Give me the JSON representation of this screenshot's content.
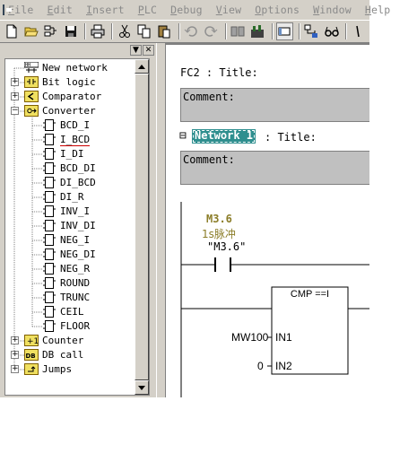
{
  "menu": [
    "File",
    "Edit",
    "Insert",
    "PLC",
    "Debug",
    "View",
    "Options",
    "Window",
    "Help"
  ],
  "menu_underline": [
    "F",
    "E",
    "I",
    "P",
    "D",
    "V",
    "O",
    "W",
    "H"
  ],
  "toolbar": [
    "new-icon",
    "open-icon",
    "accessible-nodes-icon",
    "save-icon",
    "print-icon",
    "cut-icon",
    "copy-icon",
    "paste-icon",
    "undo-icon",
    "redo-icon",
    "load-icon",
    "monitor-icon",
    "overview-icon",
    "network-icon",
    "glasses-icon",
    "overflow-icon"
  ],
  "pane_buttons": [
    "▼",
    "✕"
  ],
  "tree": [
    {
      "label": "New network",
      "level": 0,
      "expand": "",
      "icon": "new-network-icon"
    },
    {
      "label": "Bit logic",
      "level": 0,
      "expand": "+",
      "icon": "bit-logic-icon"
    },
    {
      "label": "Comparator",
      "level": 0,
      "expand": "+",
      "icon": "comparator-icon"
    },
    {
      "label": "Converter",
      "level": 0,
      "expand": "−",
      "icon": "converter-icon"
    },
    {
      "label": "BCD_I",
      "level": 1,
      "expand": "",
      "icon": "block-icon"
    },
    {
      "label": "I_BCD",
      "level": 1,
      "expand": "",
      "icon": "block-icon",
      "underline": true
    },
    {
      "label": "I_DI",
      "level": 1,
      "expand": "",
      "icon": "block-icon"
    },
    {
      "label": "BCD_DI",
      "level": 1,
      "expand": "",
      "icon": "block-icon"
    },
    {
      "label": "DI_BCD",
      "level": 1,
      "expand": "",
      "icon": "block-icon"
    },
    {
      "label": "DI_R",
      "level": 1,
      "expand": "",
      "icon": "block-icon"
    },
    {
      "label": "INV_I",
      "level": 1,
      "expand": "",
      "icon": "block-icon"
    },
    {
      "label": "INV_DI",
      "level": 1,
      "expand": "",
      "icon": "block-icon"
    },
    {
      "label": "NEG_I",
      "level": 1,
      "expand": "",
      "icon": "block-icon"
    },
    {
      "label": "NEG_DI",
      "level": 1,
      "expand": "",
      "icon": "block-icon"
    },
    {
      "label": "NEG_R",
      "level": 1,
      "expand": "",
      "icon": "block-icon"
    },
    {
      "label": "ROUND",
      "level": 1,
      "expand": "",
      "icon": "block-icon"
    },
    {
      "label": "TRUNC",
      "level": 1,
      "expand": "",
      "icon": "block-icon"
    },
    {
      "label": "CEIL",
      "level": 1,
      "expand": "",
      "icon": "block-icon"
    },
    {
      "label": "FLOOR",
      "level": 1,
      "expand": "",
      "icon": "block-icon"
    },
    {
      "label": "Counter",
      "level": 0,
      "expand": "+",
      "icon": "counter-icon"
    },
    {
      "label": "DB call",
      "level": 0,
      "expand": "+",
      "icon": "db-call-icon"
    },
    {
      "label": "Jumps",
      "level": 0,
      "expand": "+",
      "icon": "jumps-icon"
    }
  ],
  "editor": {
    "block_title": "FC2 : Title:",
    "comment1": "Comment:",
    "network_label": "Network 1",
    "network_title": ": Title:",
    "network_collapse": "⊟",
    "comment2": "Comment:",
    "contact_address": "M3.6",
    "contact_symbol": "1s脉冲",
    "contact_symbol_quoted": "\"M3.6\"",
    "box_title": "CMP ==I",
    "in1_operand": "MW100",
    "in1_pin": "IN1",
    "in2_operand": "0",
    "in2_pin": "IN2"
  },
  "colors": {
    "chrome": "#d4d0c8",
    "menu_text_disabled": "#8a8a8a",
    "comment_bg": "#c0c0c0",
    "network_label_bg": "#2f8f8f",
    "symbol_text": "#8b7d28",
    "underline": "#cc0000"
  }
}
